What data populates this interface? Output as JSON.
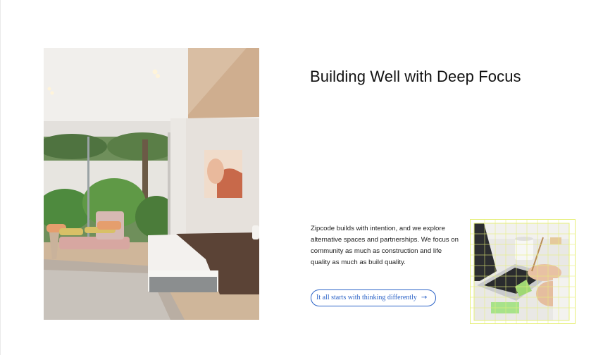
{
  "section": {
    "headline": "Building Well with Deep Focus",
    "body": "Zipcode builds with intention, and we explore alternative spaces and partnerships. We focus on community as much as construction and life quality as much as build quality.",
    "cta_label": "It all starts with thinking differently",
    "cta_arrow": "→"
  },
  "colors": {
    "accent_blue": "#2b63c7",
    "grid_yellow": "#e6ef7a"
  },
  "icons": {
    "cta": "arrow-right-icon"
  }
}
